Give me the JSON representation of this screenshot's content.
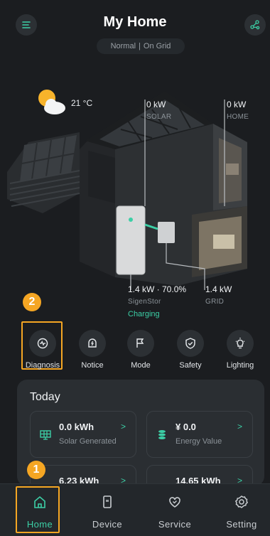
{
  "header": {
    "title": "My Home",
    "status_mode": "Normal",
    "status_sep": "|",
    "status_grid": "On Grid",
    "menu_icon": "menu-icon",
    "share_icon": "share-network-icon"
  },
  "weather": {
    "icon": "partly-cloudy-icon",
    "temperature": "21 °C"
  },
  "flows": {
    "solar": {
      "value": "0 kW",
      "label": "SOLAR"
    },
    "home": {
      "value": "0 kW",
      "label": "HOME"
    },
    "battery": {
      "value": "1.4 kW · 70.0%",
      "label": "SigenStor",
      "state": "Charging"
    },
    "grid": {
      "value": "1.4 kW",
      "label": "GRID"
    }
  },
  "badges": {
    "one": "1",
    "two": "2"
  },
  "quick_actions": [
    {
      "label": "Diagnosis",
      "icon": "diagnosis-icon"
    },
    {
      "label": "Notice",
      "icon": "notice-icon"
    },
    {
      "label": "Mode",
      "icon": "mode-icon"
    },
    {
      "label": "Safety",
      "icon": "shield-icon"
    },
    {
      "label": "Lighting",
      "icon": "lightbulb-icon"
    }
  ],
  "today": {
    "title": "Today",
    "tiles": [
      {
        "value": "0.0 kWh",
        "label": "Solar Generated",
        "icon": "solar-panel-icon"
      },
      {
        "value": "¥ 0.0",
        "label": "Energy Value",
        "icon": "coin-stack-icon"
      },
      {
        "value": "6.23 kWh",
        "label": "",
        "icon": "battery-icon"
      },
      {
        "value": "14.65 kWh",
        "label": "",
        "icon": "grid-icon"
      }
    ],
    "chevron": ">"
  },
  "nav": [
    {
      "label": "Home",
      "icon": "home-icon",
      "active": true
    },
    {
      "label": "Device",
      "icon": "device-icon",
      "active": false
    },
    {
      "label": "Service",
      "icon": "service-icon",
      "active": false
    },
    {
      "label": "Setting",
      "icon": "gear-icon",
      "active": false
    }
  ],
  "colors": {
    "accent": "#3ccfa6",
    "highlight": "#f5a623",
    "background": "#1b1d20"
  }
}
